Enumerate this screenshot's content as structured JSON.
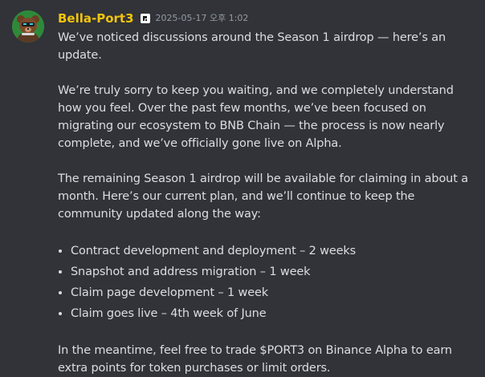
{
  "message": {
    "author": {
      "username": "Bella-Port3",
      "name_color": "#f1c40f",
      "avatar_icon": "bear-avatar-icon",
      "role_icon": "port3-logo-icon"
    },
    "timestamp": "2025-05-17 오후 1:02",
    "paragraphs": [
      "We’ve noticed discussions around the Season 1 airdrop — here’s an update.",
      "We’re truly sorry to keep you waiting, and we completely understand how you feel. Over the past few months, we’ve been focused on migrating our ecosystem to BNB Chain — the process is now nearly complete, and we’ve officially gone live on Alpha.",
      "The remaining Season 1 airdrop will be available for claiming in about a month. Here’s our current plan, and we’ll continue to keep the community updated along the way:"
    ],
    "plan_items": [
      "Contract development and deployment – 2 weeks",
      "Snapshot and address migration – 1 week",
      "Claim page development – 1 week",
      "Claim goes live – 4th week of June"
    ],
    "closing": "In the meantime, feel free to trade $PORT3 on Binance Alpha to earn extra points for token purchases or limit orders."
  },
  "colors": {
    "background": "#313338",
    "text": "#dbdee1",
    "muted": "#949ba4"
  }
}
